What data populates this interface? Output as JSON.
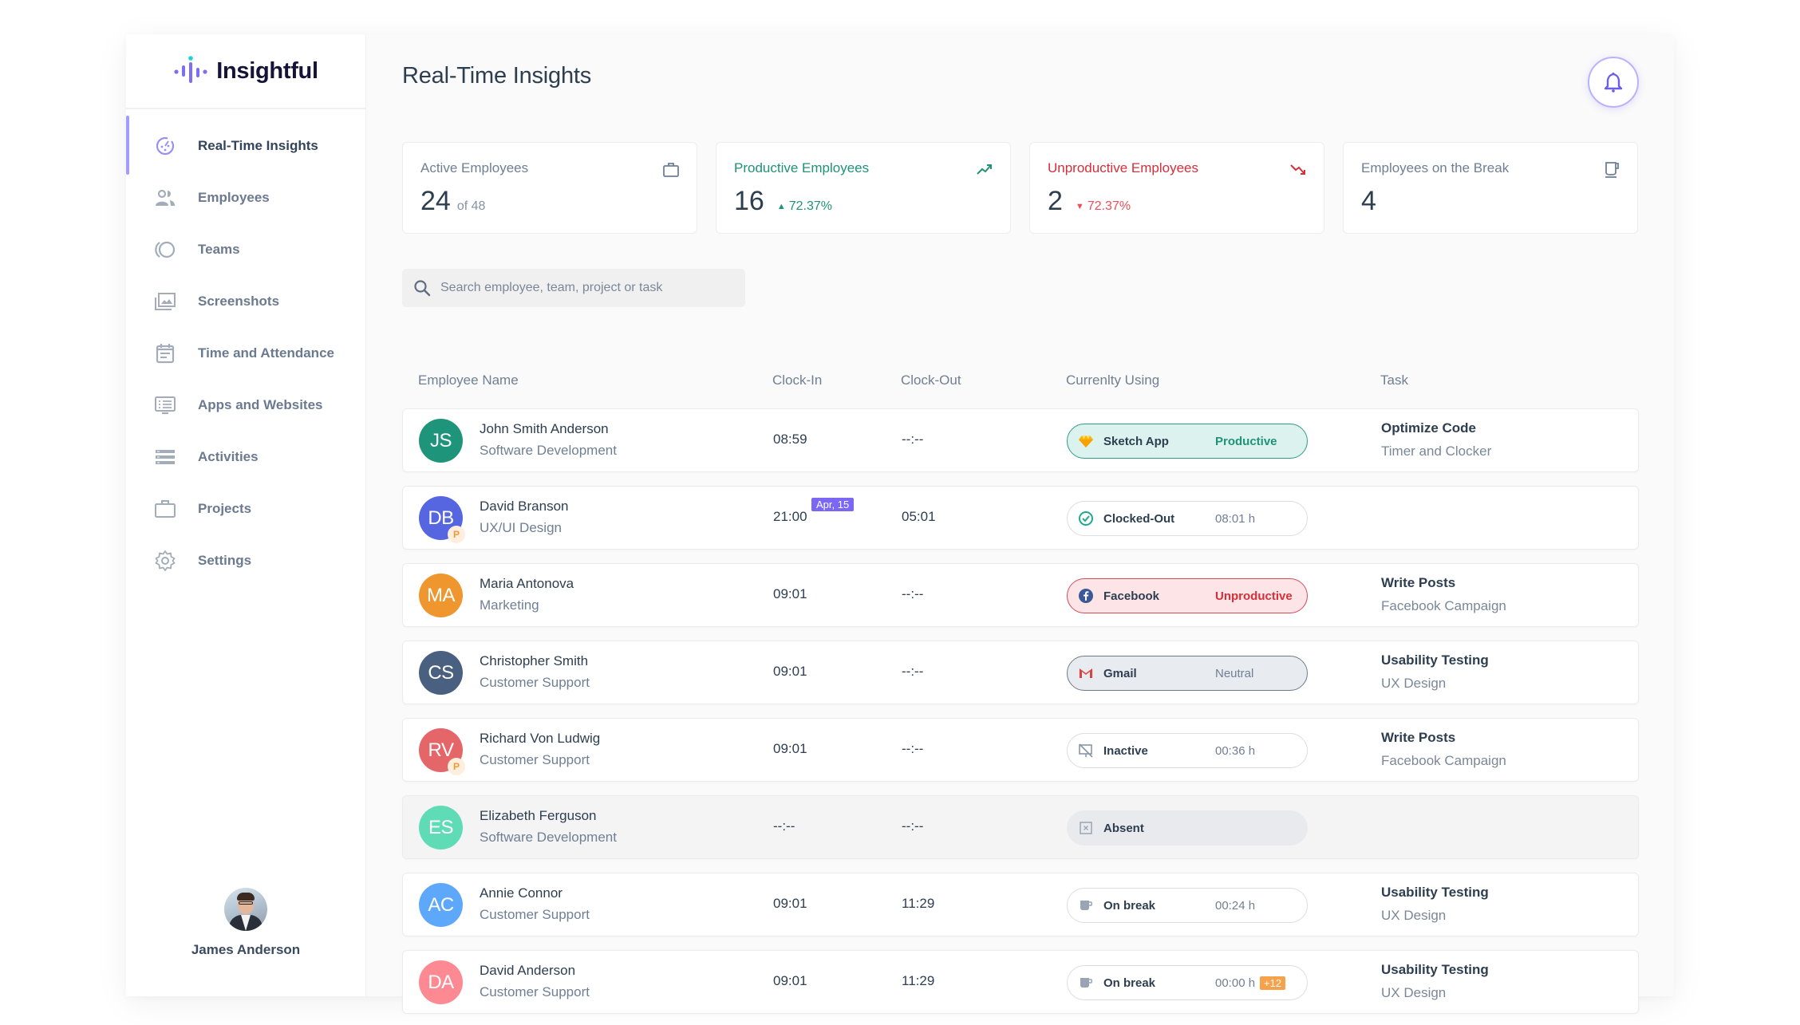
{
  "app": {
    "brand": "Insightful",
    "page_title": "Real-Time Insights"
  },
  "sidebar": {
    "items": [
      {
        "label": "Real-Time Insights",
        "icon": "realtime-icon",
        "active": true
      },
      {
        "label": "Employees",
        "icon": "employees-icon"
      },
      {
        "label": "Teams",
        "icon": "teams-icon"
      },
      {
        "label": "Screenshots",
        "icon": "screenshots-icon"
      },
      {
        "label": "Time and Attendance",
        "icon": "calendar-icon"
      },
      {
        "label": "Apps and Websites",
        "icon": "apps-icon"
      },
      {
        "label": "Activities",
        "icon": "activities-icon"
      },
      {
        "label": "Projects",
        "icon": "briefcase-icon"
      },
      {
        "label": "Settings",
        "icon": "gear-icon"
      }
    ],
    "user": {
      "name": "James Anderson"
    }
  },
  "header": {
    "notification_icon": "bell-icon"
  },
  "stats": [
    {
      "title": "Active Employees",
      "value": "24",
      "sub": "of 48",
      "icon": "briefcase-icon"
    },
    {
      "title": "Productive Employees",
      "value": "16",
      "delta": "72.37%",
      "direction": "up",
      "icon": "trend-up-icon"
    },
    {
      "title": "Unproductive Employees",
      "value": "2",
      "delta": "72.37%",
      "direction": "down",
      "icon": "trend-down-icon"
    },
    {
      "title": "Employees on the Break",
      "value": "4",
      "icon": "coffee-icon"
    }
  ],
  "search": {
    "placeholder": "Search employee, team, project or task",
    "value": ""
  },
  "table": {
    "headers": {
      "name": "Employee Name",
      "clock_in": "Clock-In",
      "clock_out": "Clock-Out",
      "using": "Currenlty Using",
      "task": "Task"
    },
    "rows": [
      {
        "initials": "JS",
        "avatar_color": "#1e957a",
        "name": "John Smith Anderson",
        "dept": "Software Development",
        "clock_in": "08:59",
        "clock_out": "--:--",
        "using": {
          "type": "productive",
          "icon": "sketch-icon",
          "label": "Sketch App",
          "status": "Productive"
        },
        "task": {
          "title": "Optimize Code",
          "project": "Timer and Clocker"
        }
      },
      {
        "initials": "DB",
        "avatar_color": "#5566e0",
        "badge": "P",
        "name": "David Branson",
        "dept": "UX/UI Design",
        "clock_in": "21:00",
        "clock_in_date": "Apr, 15",
        "clock_out": "05:01",
        "using": {
          "type": "clocked-out",
          "icon": "check-circle-icon",
          "label": "Clocked-Out",
          "status": "08:01 h"
        },
        "task": {
          "title": "",
          "project": ""
        }
      },
      {
        "initials": "MA",
        "avatar_color": "#f0962f",
        "name": "Maria Antonova",
        "dept": "Marketing",
        "clock_in": "09:01",
        "clock_out": "--:--",
        "using": {
          "type": "unproductive",
          "icon": "facebook-icon",
          "label": "Facebook",
          "status": "Unproductive"
        },
        "task": {
          "title": "Write Posts",
          "project": "Facebook Campaign"
        }
      },
      {
        "initials": "CS",
        "avatar_color": "#4a6080",
        "name": "Christopher Smith",
        "dept": "Customer Support",
        "clock_in": "09:01",
        "clock_out": "--:--",
        "using": {
          "type": "neutral",
          "icon": "gmail-icon",
          "label": "Gmail",
          "status": "Neutral"
        },
        "task": {
          "title": "Usability Testing",
          "project": "UX Design"
        }
      },
      {
        "initials": "RV",
        "avatar_color": "#e46669",
        "badge": "P",
        "name": "Richard Von Ludwig",
        "dept": "Customer Support",
        "clock_in": "09:01",
        "clock_out": "--:--",
        "using": {
          "type": "inactive",
          "icon": "inactive-screen-icon",
          "label": "Inactive",
          "status": "00:36 h"
        },
        "task": {
          "title": "Write Posts",
          "project": "Facebook Campaign"
        }
      },
      {
        "initials": "ES",
        "avatar_color": "#5fdcb6",
        "name": "Elizabeth Ferguson",
        "dept": "Software Development",
        "clock_in": "--:--",
        "clock_out": "--:--",
        "absent": true,
        "using": {
          "type": "absent",
          "icon": "absent-icon",
          "label": "Absent",
          "status": ""
        },
        "task": {
          "title": "",
          "project": ""
        }
      },
      {
        "initials": "AC",
        "avatar_color": "#5ea8fb",
        "name": "Annie Connor",
        "dept": "Customer Support",
        "clock_in": "09:01",
        "clock_out": "11:29",
        "using": {
          "type": "break",
          "icon": "coffee-icon",
          "label": "On break",
          "status": "00:24 h"
        },
        "task": {
          "title": "Usability Testing",
          "project": "UX Design"
        }
      },
      {
        "initials": "DA",
        "avatar_color": "#fd8a93",
        "name": "David Anderson",
        "dept": "Customer Support",
        "clock_in": "09:01",
        "clock_out": "11:29",
        "using": {
          "type": "break",
          "icon": "coffee-icon",
          "label": "On break",
          "status": "00:00 h",
          "extra": "+12"
        },
        "task": {
          "title": "Usability Testing",
          "project": "UX Design"
        }
      }
    ]
  },
  "colors": {
    "accent": "#6c5ce7",
    "productive": "#1f9277",
    "unproductive": "#d52f3a",
    "neutral": "#6f7f94",
    "warning": "#f7a14a"
  }
}
